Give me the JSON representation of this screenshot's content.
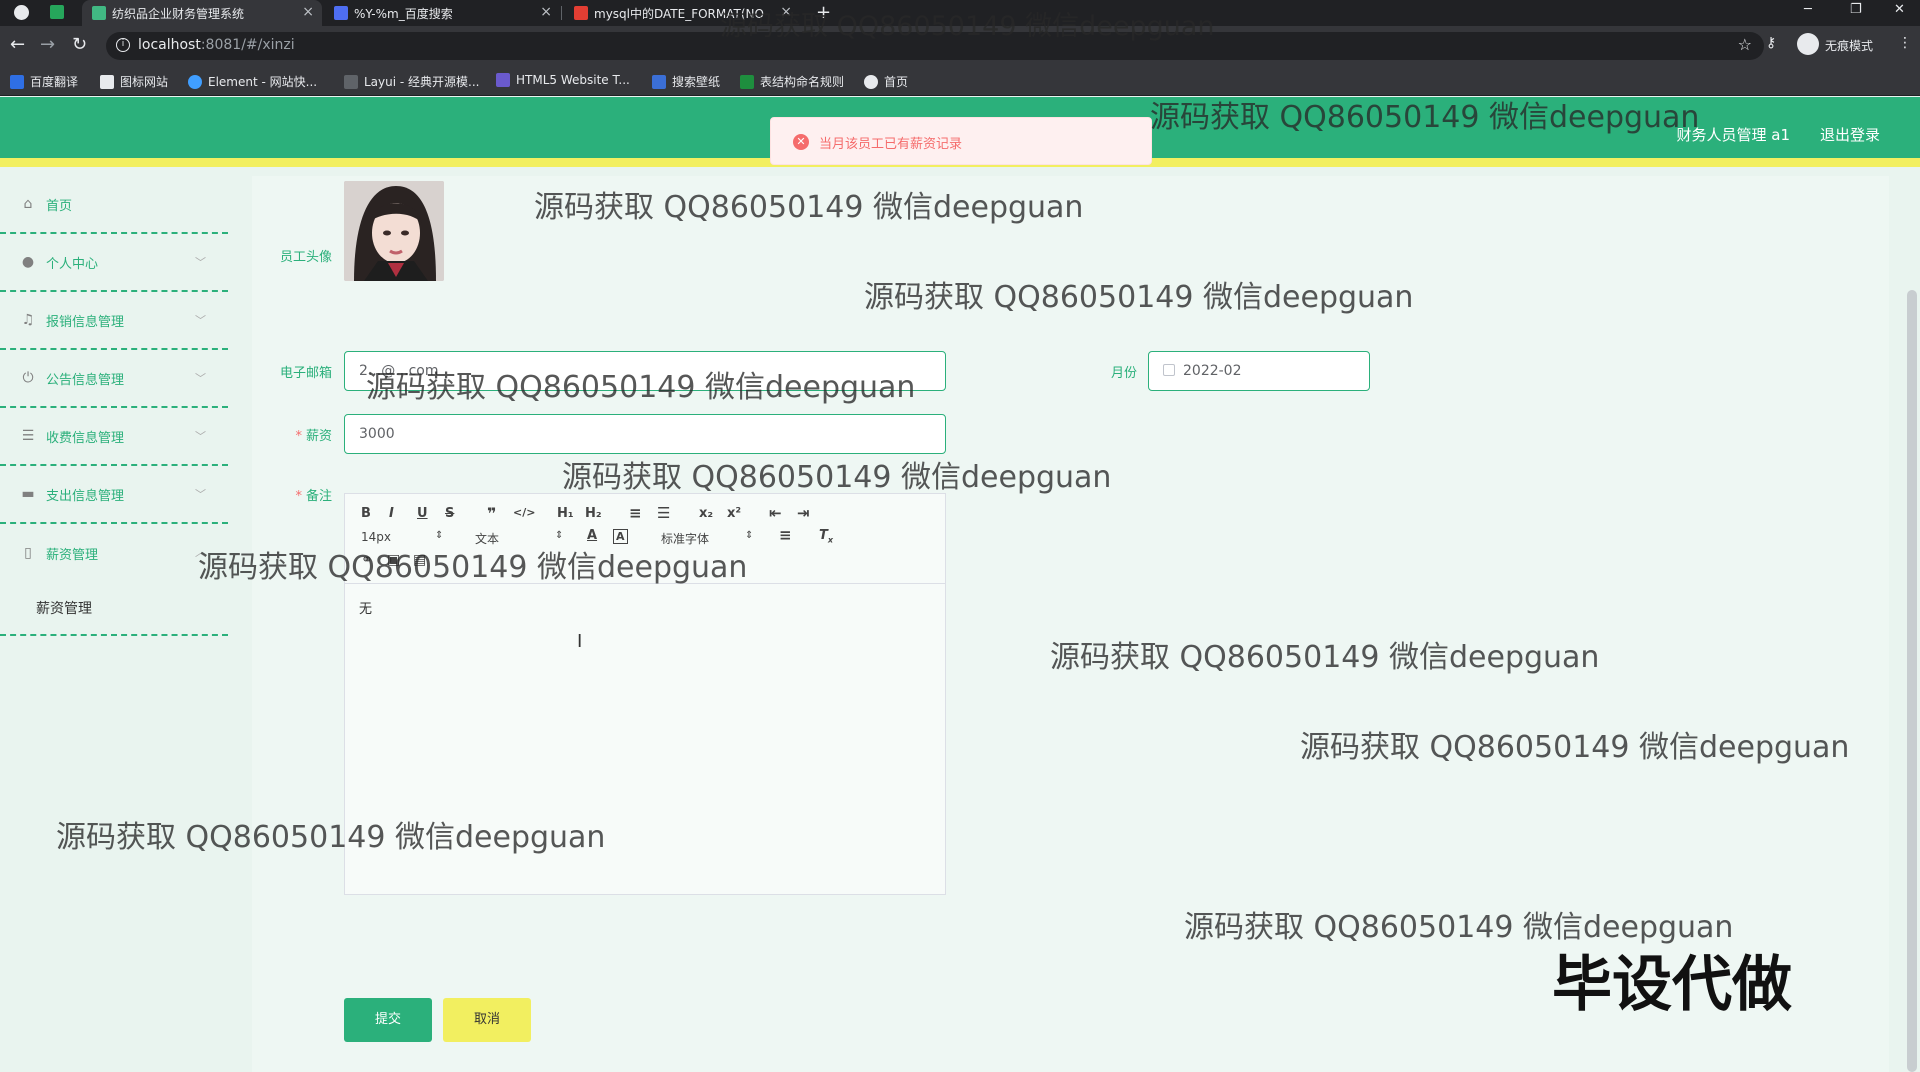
{
  "browser": {
    "tabs": [
      {
        "title": "纺织品企业财务管理系统"
      },
      {
        "title": "%Y-%m_百度搜索"
      },
      {
        "title": "mysql中的DATE_FORMAT(NO"
      }
    ],
    "url_host": "localhost",
    "url_rest": ":8081/#/xinzi",
    "profile_label": "无痕模式",
    "bookmarks": [
      "百度翻译",
      "图标网站",
      "Element - 网站快...",
      "Layui - 经典开源模...",
      "HTML5 Website T...",
      "搜索壁纸",
      "表结构命名规则",
      "首页"
    ]
  },
  "header": {
    "user_label": "财务人员管理 a1",
    "logout_label": "退出登录"
  },
  "toast": {
    "message": "当月该员工已有薪资记录",
    "type": "error",
    "color": "#f56c6c"
  },
  "sidebar": {
    "items": [
      {
        "label": "首页",
        "icon": "home-icon"
      },
      {
        "label": "个人中心",
        "icon": "user-icon"
      },
      {
        "label": "报销信息管理",
        "icon": "bell-icon"
      },
      {
        "label": "公告信息管理",
        "icon": "power-icon"
      },
      {
        "label": "收费信息管理",
        "icon": "list-icon"
      },
      {
        "label": "支出信息管理",
        "icon": "briefcase-icon"
      },
      {
        "label": "薪资管理",
        "icon": "phone-icon"
      }
    ],
    "submenu_label": "薪资管理"
  },
  "form": {
    "avatar_label": "员工头像",
    "email_label": "电子邮箱",
    "email_value": "2...@...com",
    "month_label": "月份",
    "month_value": "2022-02",
    "salary_label": "薪资",
    "salary_value": "3000",
    "remark_label": "备注",
    "remark_value": "无",
    "submit_label": "提交",
    "cancel_label": "取消"
  },
  "editor_toolbar": {
    "font_size": "14px",
    "header_select": "文本",
    "font_family": "标准字体",
    "buttons": [
      "bold",
      "italic",
      "underline",
      "strike",
      "blockquote",
      "code-block",
      "h1",
      "h2",
      "ordered-list",
      "bullet-list",
      "subscript",
      "superscript",
      "indent-decrease",
      "indent-increase",
      "color",
      "background",
      "align",
      "clean",
      "link",
      "image",
      "video"
    ]
  },
  "watermarks": {
    "text": "源码获取 QQ86050149 微信deepguan",
    "big_text": "毕设代做"
  },
  "colors": {
    "brand": "#2bb07b",
    "accent": "#f2ef60",
    "error": "#f56c6c"
  }
}
